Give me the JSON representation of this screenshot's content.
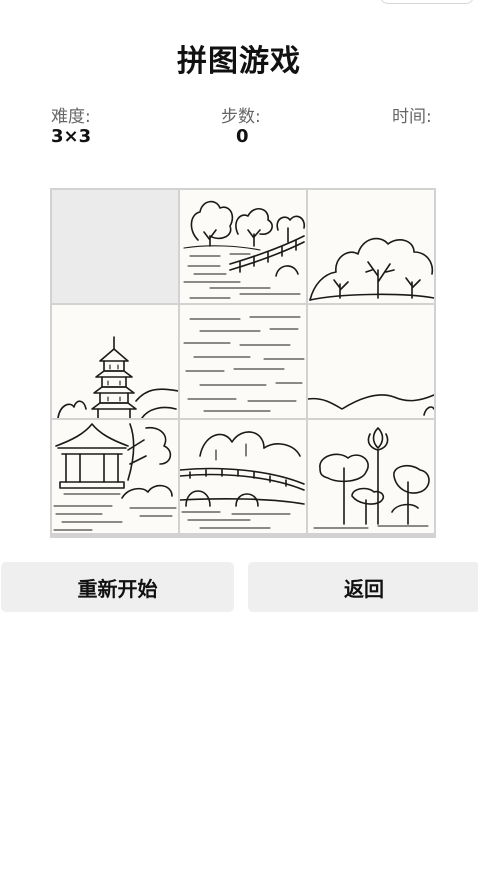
{
  "title": "拼图游戏",
  "stats": {
    "difficulty_label": "难度:",
    "difficulty_value": "3×3",
    "steps_label": "步数:",
    "steps_value": "0",
    "time_label": "时间:",
    "time_value": ""
  },
  "puzzle": {
    "grid": "3x3",
    "empty_position": 1,
    "tiles": [
      {
        "position": 1,
        "scene": "empty"
      },
      {
        "position": 2,
        "scene": "trees-and-bridge"
      },
      {
        "position": 3,
        "scene": "tree-on-hill"
      },
      {
        "position": 4,
        "scene": "pagoda"
      },
      {
        "position": 5,
        "scene": "water-ripples"
      },
      {
        "position": 6,
        "scene": "distant-hills"
      },
      {
        "position": 7,
        "scene": "pavilion"
      },
      {
        "position": 8,
        "scene": "arch-bridge"
      },
      {
        "position": 9,
        "scene": "lotus"
      }
    ]
  },
  "buttons": {
    "restart_label": "重新开始",
    "back_label": "返回"
  },
  "colors": {
    "button_bg": "#efefef",
    "board_border": "#d2d2d2",
    "empty_tile": "#ebebeb",
    "tile_bg": "#fcfbf7"
  }
}
